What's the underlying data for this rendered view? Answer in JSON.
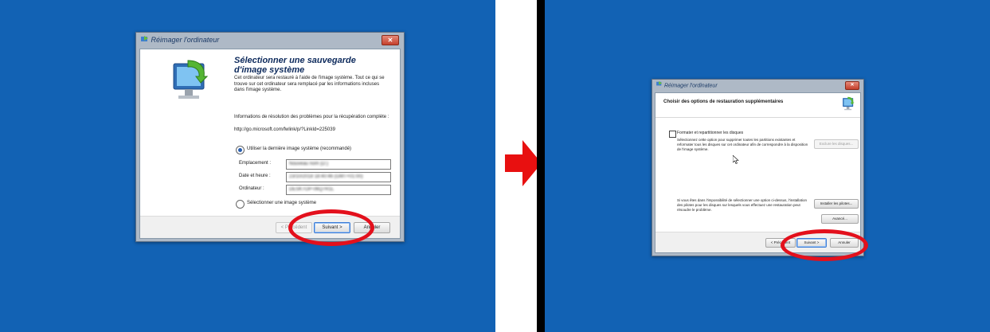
{
  "left": {
    "title": "Réimager l'ordinateur",
    "close_glyph": "✕",
    "heading": "Sélectionner une sauvegarde d'image système",
    "intro": "Cet ordinateur sera restauré à l'aide de l'image système. Tout ce qui se trouve sur cet ordinateur sera remplacé par les informations incluses dans l'image système.",
    "troubleshoot": "Informations de résolution des problèmes pour la récupération complète :",
    "link": "http://go.microsoft.com/fwlink/p/?LinkId=225039",
    "option_latest": "Utiliser la dernière image système (recommandé)",
    "location_label": "Emplacement :",
    "location_value": "Nouveau nom (D:)",
    "datetime_label": "Date et heure :",
    "datetime_value": "23/10/2018 18:40:46 (GMT+01:00)",
    "computer_label": "Ordinateur :",
    "computer_value": "DESKTOP-06Q7R1L",
    "option_select": "Sélectionner une image système",
    "btn_prev": "< Précédent",
    "btn_next": "Suivant >",
    "btn_cancel": "Annuler"
  },
  "right": {
    "title": "Réimager l'ordinateur",
    "close_glyph": "✕",
    "header": "Choisir des options de restauration supplémentaires",
    "format_checkbox": "Formater et repartitionner les disques",
    "format_desc": "Sélectionnez cette option pour supprimer toutes les partitions existantes et reformater tous les disques sur cet ordinateur afin de correspondre à la disposition de l'image système.",
    "btn_exclude": "Exclure les disques...",
    "drivers_desc": "Si vous êtes dans l'impossibilité de sélectionner une option ci-dessus, l'installation des pilotes pour les disques sur lesquels vous effectuez une restauration peut résoudre le problème.",
    "btn_install": "Installer les pilotes...",
    "btn_advanced": "Avancé...",
    "btn_prev": "< Précédent",
    "btn_next": "Suivant >",
    "btn_cancel": "Annuler"
  },
  "colors": {
    "desktop": "#1262b4",
    "annotation": "#e3101c",
    "arrow": "#e81010"
  },
  "icons": [
    "computer-restore-icon",
    "red-arrow-icon",
    "mouse-cursor-icon"
  ]
}
